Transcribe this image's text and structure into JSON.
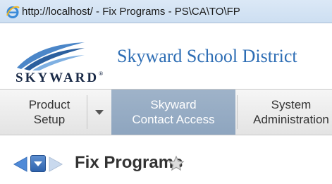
{
  "window": {
    "title": "http://localhost/ - Fix Programs - PS\\CA\\TO\\FP",
    "icon": "ie-icon"
  },
  "header": {
    "logo_text": "SKYWARD",
    "logo_tm": "®",
    "district_name": "Skyward School District"
  },
  "menu": {
    "items": [
      {
        "line1": "Product",
        "line2": "Setup"
      },
      {
        "line1": "Skyward",
        "line2": "Contact Access",
        "active": true
      },
      {
        "line1": "System",
        "line2": "Administration"
      }
    ]
  },
  "page": {
    "title": "Fix Programs"
  },
  "colors": {
    "accent_blue": "#2d6db4",
    "active_menu": "#96abc4",
    "nav_arrow": "#4f8ad8"
  }
}
